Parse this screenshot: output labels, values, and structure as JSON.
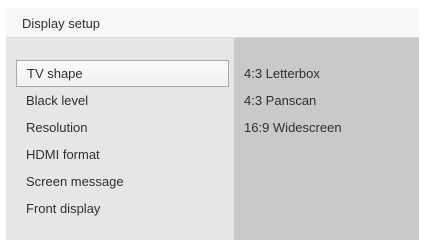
{
  "window": {
    "title": "Display setup"
  },
  "menu": {
    "items": [
      {
        "label": "TV shape",
        "selected": true
      },
      {
        "label": "Black level",
        "selected": false
      },
      {
        "label": "Resolution",
        "selected": false
      },
      {
        "label": "HDMI format",
        "selected": false
      },
      {
        "label": "Screen message",
        "selected": false
      },
      {
        "label": "Front display",
        "selected": false
      }
    ]
  },
  "options": {
    "items": [
      {
        "label": "4:3 Letterbox"
      },
      {
        "label": "4:3 Panscan"
      },
      {
        "label": "16:9 Widescreen"
      }
    ]
  },
  "colors": {
    "title_bar_bg": "#f7f7f7",
    "left_panel_bg": "#e6e6e6",
    "right_panel_bg": "#c9c9c9",
    "selection_border": "#a9a9a9",
    "text": "#2f2f2f"
  }
}
